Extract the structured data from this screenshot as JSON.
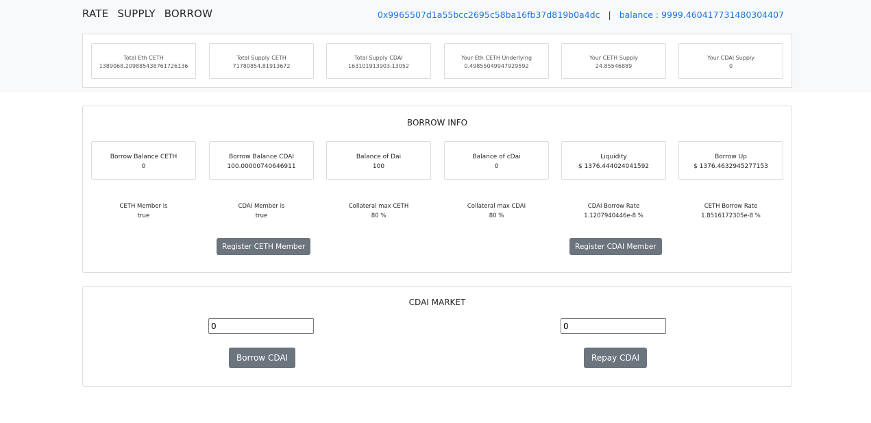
{
  "nav": {
    "rate": "RATE",
    "supply": "SUPPLY",
    "borrow": "BORROW"
  },
  "account": {
    "address": "0x9965507d1a55bcc2695c58ba16fb37d819b0a4dc",
    "separator": "|",
    "balance": "balance : 9999.460417731480304407"
  },
  "stats": [
    {
      "label": "Total Eth CETH",
      "value": "1389068.209885438761726136"
    },
    {
      "label": "Total Supply CETH",
      "value": "71780854.81913672"
    },
    {
      "label": "Total Supply CDAI",
      "value": "163101913903.13052"
    },
    {
      "label": "Your Eth CETH Underlying",
      "value": "0.49855049947929592"
    },
    {
      "label": "Your CETH Supply",
      "value": "24.85546889"
    },
    {
      "label": "Your CDAI Supply",
      "value": "0"
    }
  ],
  "borrow_info": {
    "title": "BORROW INFO",
    "cards": [
      {
        "label": "Borrow Balance CETH",
        "value": "0"
      },
      {
        "label": "Borrow Balance CDAI",
        "value": "100.00000740646911"
      },
      {
        "label": "Balance of Dai",
        "value": "100"
      },
      {
        "label": "Balance of cDai",
        "value": "0"
      },
      {
        "label": "Liquidity",
        "value": "$ 1376.444024041592"
      },
      {
        "label": "Borrow Up",
        "value": "$ 1376.4632945277153"
      }
    ],
    "details": [
      {
        "label": "CETH Member is",
        "value": "true"
      },
      {
        "label": "CDAI Member is",
        "value": "true"
      },
      {
        "label": "Collateral max CETH",
        "value": "80 %"
      },
      {
        "label": "Collateral max CDAI",
        "value": "80 %"
      },
      {
        "label": "CDAI Borrow Rate",
        "value": "1.1207940446e-8 %"
      },
      {
        "label": "CETH Borrow Rate",
        "value": "1.8516172305e-8 %"
      }
    ],
    "register_ceth": "Register CETH Member",
    "register_cdai": "Register CDAI Member"
  },
  "market": {
    "title": "CDAI MARKET",
    "borrow_value": "0",
    "repay_value": "0",
    "borrow_button": "Borrow CDAI",
    "repay_button": "Repay CDAI"
  }
}
